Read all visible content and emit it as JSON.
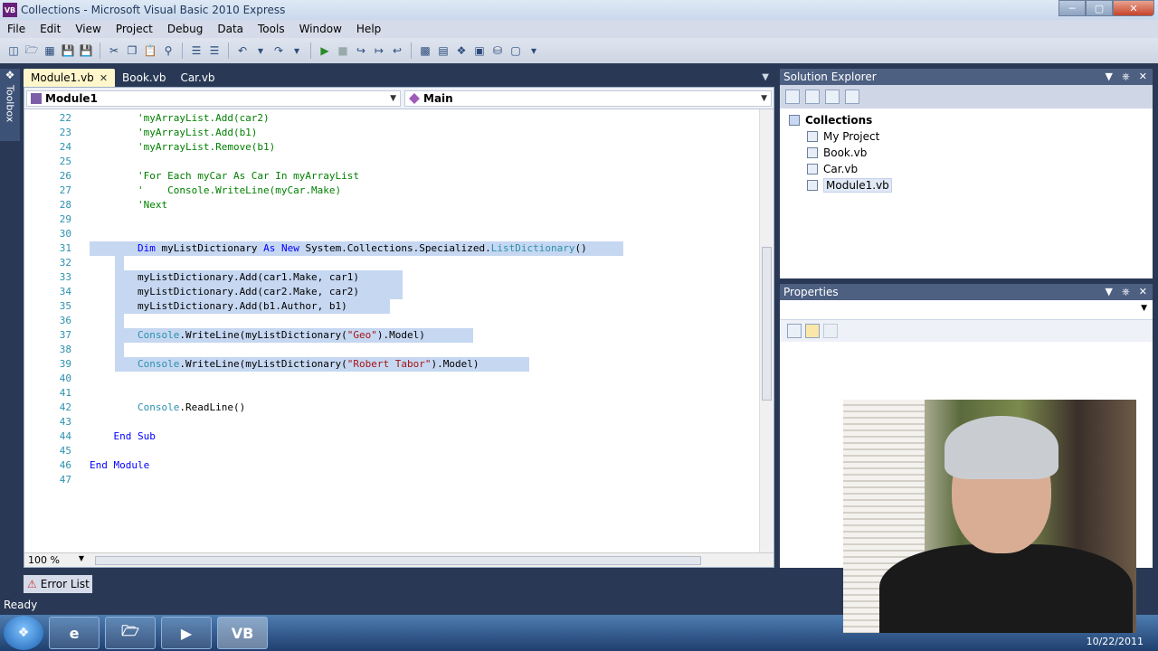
{
  "window": {
    "title": "Collections - Microsoft Visual Basic 2010 Express",
    "app_icon": "VB"
  },
  "menu": [
    "File",
    "Edit",
    "View",
    "Project",
    "Debug",
    "Data",
    "Tools",
    "Window",
    "Help"
  ],
  "toolbox": {
    "label": "Toolbox"
  },
  "doc_tabs": [
    {
      "label": "Module1.vb",
      "active": true
    },
    {
      "label": "Book.vb",
      "active": false
    },
    {
      "label": "Car.vb",
      "active": false
    }
  ],
  "nav": {
    "left": "Module1",
    "right": "Main"
  },
  "code_lines": [
    {
      "n": "22",
      "t": "        'myArrayList.Add(car2)",
      "c": "cm"
    },
    {
      "n": "23",
      "t": "        'myArrayList.Add(b1)",
      "c": "cm"
    },
    {
      "n": "24",
      "t": "        'myArrayList.Remove(b1)",
      "c": "cm"
    },
    {
      "n": "25",
      "t": "",
      "c": ""
    },
    {
      "n": "26",
      "t": "        'For Each myCar As Car In myArrayList",
      "c": "cm"
    },
    {
      "n": "27",
      "t": "        '    Console.WriteLine(myCar.Make)",
      "c": "cm"
    },
    {
      "n": "28",
      "t": "        'Next",
      "c": "cm"
    },
    {
      "n": "29",
      "t": "",
      "c": ""
    },
    {
      "n": "30",
      "t": "",
      "c": ""
    },
    {
      "n": "31",
      "t": "        Dim myListDictionary As New System.Collections.Specialized.ListDictionary()",
      "c": "",
      "sel": 590
    },
    {
      "n": "32",
      "t": "",
      "c": "",
      "sel": 10
    },
    {
      "n": "33",
      "t": "        myListDictionary.Add(car1.Make, car1)",
      "c": "",
      "sel": 318
    },
    {
      "n": "34",
      "t": "        myListDictionary.Add(car2.Make, car2)",
      "c": "",
      "sel": 318
    },
    {
      "n": "35",
      "t": "        myListDictionary.Add(b1.Author, b1)",
      "c": "",
      "sel": 304
    },
    {
      "n": "36",
      "t": "",
      "c": "",
      "sel": 10
    },
    {
      "n": "37",
      "t": "        Console.WriteLine(myListDictionary(\"Geo\").Model)",
      "c": "",
      "sel": 396
    },
    {
      "n": "38",
      "t": "",
      "c": "",
      "sel": 10
    },
    {
      "n": "39",
      "t": "        Console.WriteLine(myListDictionary(\"Robert Tabor\").Model)",
      "c": "",
      "sel": 458
    },
    {
      "n": "40",
      "t": "",
      "c": ""
    },
    {
      "n": "41",
      "t": "",
      "c": ""
    },
    {
      "n": "42",
      "t": "        Console.ReadLine()",
      "c": ""
    },
    {
      "n": "43",
      "t": "",
      "c": ""
    },
    {
      "n": "44",
      "t": "    End Sub",
      "c": ""
    },
    {
      "n": "45",
      "t": "",
      "c": ""
    },
    {
      "n": "46",
      "t": "End Module",
      "c": ""
    },
    {
      "n": "47",
      "t": "",
      "c": ""
    }
  ],
  "editor": {
    "zoom": "100 %"
  },
  "solution_explorer": {
    "title": "Solution Explorer",
    "root": "Collections",
    "items": [
      "My Project",
      "Book.vb",
      "Car.vb",
      "Module1.vb"
    ],
    "selected": "Module1.vb"
  },
  "properties": {
    "title": "Properties"
  },
  "error_list": {
    "label": "Error List"
  },
  "status": {
    "text": "Ready"
  },
  "taskbar": {
    "clock": "10/22/2011"
  },
  "colors": {
    "accent": "#293955",
    "selection": "#c6d7f1",
    "keyword": "#0000ff",
    "comment": "#008000",
    "string": "#a31515",
    "type": "#2b91af"
  }
}
